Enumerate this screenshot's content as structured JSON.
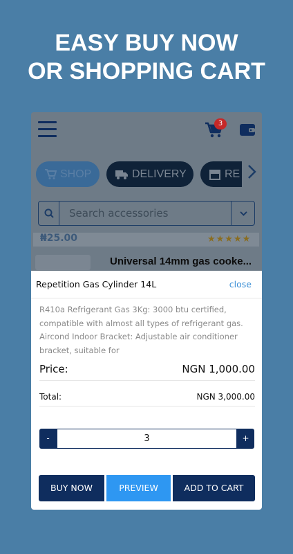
{
  "headline": {
    "line1": "EASY BUY NOW",
    "line2": "OR SHOPPING CART"
  },
  "app": {
    "cart_count": "3",
    "tabs": [
      {
        "label": "SHOP",
        "icon": "cart-icon"
      },
      {
        "label": "DELIVERY",
        "icon": "truck-icon"
      },
      {
        "label": "RE",
        "icon": "store-icon"
      }
    ],
    "search": {
      "placeholder": "Search accessories"
    },
    "price_strip": "₦25.00",
    "stars": "★★★★★",
    "product_title": "Universal 14mm gas cooke..."
  },
  "modal": {
    "title": "Repetition Gas Cylinder 14L",
    "close_label": "close",
    "description": "R410a Refrigerant Gas 3Kg: 3000 btu certified, compatible with almost all types of refrigerant gas. Aircond Indoor Bracket: Adjustable air conditioner bracket, suitable for",
    "price_label": "Price:",
    "price_value": "NGN 1,000.00",
    "total_label": "Total:",
    "total_value": "NGN 3,000.00",
    "quantity": "3",
    "minus_label": "-",
    "plus_label": "+",
    "buy_now_label": "BUY NOW",
    "preview_label": "PREVIEW",
    "add_to_cart_label": "ADD TO CART"
  },
  "colors": {
    "background": "#4a7ea6",
    "navy": "#0f2d5e",
    "accent_blue": "#2e97f2",
    "link_blue": "#3b8fd6",
    "badge_red": "#c62828"
  }
}
